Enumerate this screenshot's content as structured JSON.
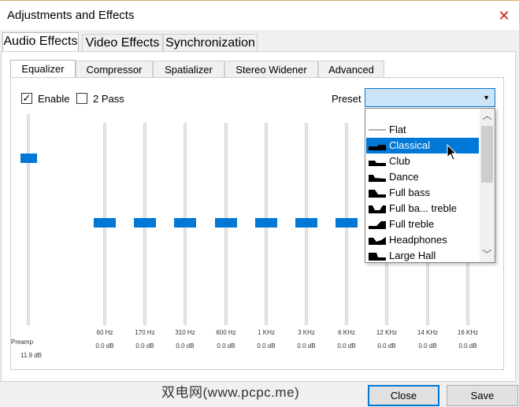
{
  "window": {
    "title": "Adjustments and Effects"
  },
  "tabs": [
    {
      "label": "Audio Effects"
    },
    {
      "label": "Video Effects"
    },
    {
      "label": "Synchronization"
    }
  ],
  "subtabs": [
    {
      "label": "Equalizer"
    },
    {
      "label": "Compressor"
    },
    {
      "label": "Spatializer"
    },
    {
      "label": "Stereo Widener"
    },
    {
      "label": "Advanced"
    }
  ],
  "options": {
    "enable_label": "Enable",
    "enable_checked": true,
    "twopass_label": "2 Pass",
    "twopass_checked": false,
    "preset_label": "Preset"
  },
  "preamp": {
    "label": "Preamp",
    "value": "11.9 dB",
    "level": 0.76
  },
  "bands": [
    {
      "freq": "60 Hz",
      "value": "0.0 dB"
    },
    {
      "freq": "170 Hz",
      "value": "0.0 dB"
    },
    {
      "freq": "310 Hz",
      "value": "0.0 dB"
    },
    {
      "freq": "600 Hz",
      "value": "0.0 dB"
    },
    {
      "freq": "1 KHz",
      "value": "0.0 dB"
    },
    {
      "freq": "3 KHz",
      "value": "0.0 dB"
    },
    {
      "freq": "6 KHz",
      "value": "0.0 dB"
    },
    {
      "freq": "12 KHz",
      "value": "0.0 dB"
    },
    {
      "freq": "14 KHz",
      "value": "0.0 dB"
    },
    {
      "freq": "16 KHz",
      "value": "0.0 dB"
    }
  ],
  "preset_dropdown": {
    "selected": "Classical",
    "items": [
      {
        "label": "Flat",
        "icon": "flat-curve-icon"
      },
      {
        "label": "Classical",
        "icon": "classical-curve-icon"
      },
      {
        "label": "Club",
        "icon": "club-curve-icon"
      },
      {
        "label": "Dance",
        "icon": "dance-curve-icon"
      },
      {
        "label": "Full bass",
        "icon": "full-bass-curve-icon"
      },
      {
        "label": "Full ba... treble",
        "icon": "full-bass-treble-curve-icon"
      },
      {
        "label": "Full treble",
        "icon": "full-treble-curve-icon"
      },
      {
        "label": "Headphones",
        "icon": "headphones-curve-icon"
      },
      {
        "label": "Large Hall",
        "icon": "large-hall-curve-icon"
      }
    ]
  },
  "buttons": {
    "close": "Close",
    "save": "Save"
  },
  "watermark": "双电网(www.pcpc.me)",
  "colors": {
    "accent": "#0078d7",
    "selection": "#0078d7",
    "close_icon": "#c42b1c"
  }
}
